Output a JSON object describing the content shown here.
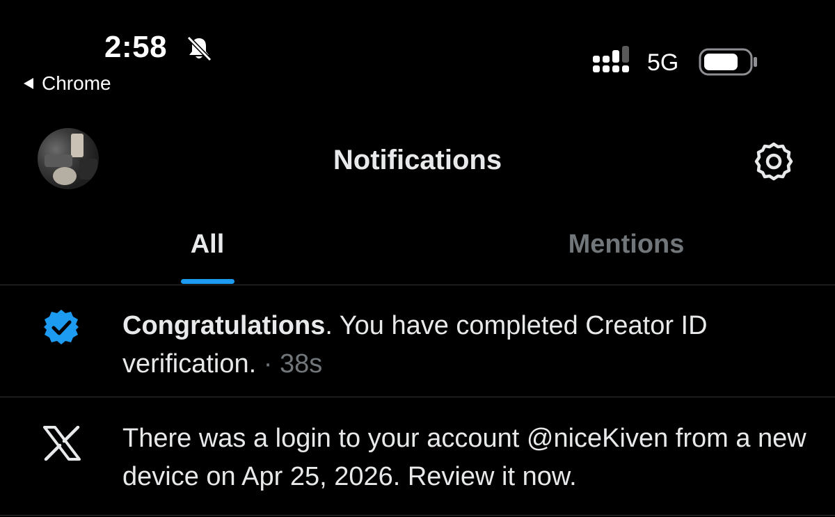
{
  "status_bar": {
    "time": "2:58",
    "back_app": "Chrome",
    "network": "5G"
  },
  "header": {
    "title": "Notifications"
  },
  "tabs": [
    {
      "label": "All",
      "active": true
    },
    {
      "label": "Mentions",
      "active": false
    }
  ],
  "colors": {
    "accent": "#1d9bf0",
    "background": "#000000",
    "text": "#e7e9ea",
    "muted": "#71767b"
  },
  "notifications": [
    {
      "icon": "verified-badge-icon",
      "bold": "Congratulations",
      "text": ".  You have completed Creator ID verification.",
      "separator": " · ",
      "time": "38s"
    },
    {
      "icon": "x-logo-icon",
      "text": "There was a login to your account @niceKiven from a new device on Apr 25, 2026. Review it now."
    }
  ]
}
